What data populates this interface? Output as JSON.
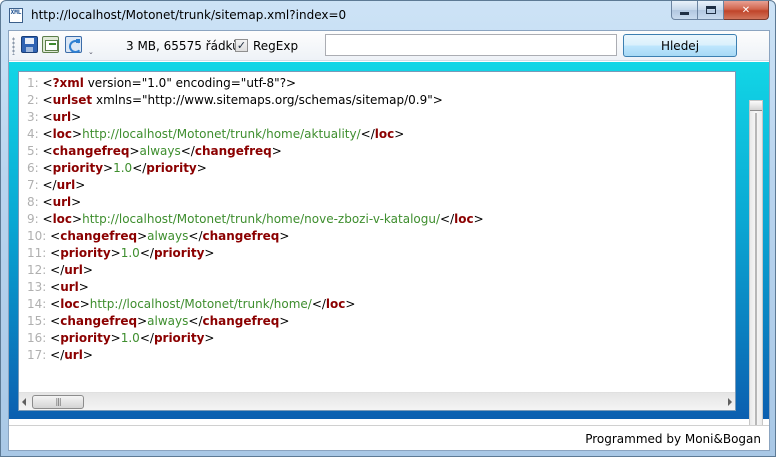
{
  "window": {
    "title": "http://localhost/Motonet/trunk/sitemap.xml?index=0",
    "app_icon_text": "XML",
    "minimize": "",
    "maximize": "",
    "close": "✕"
  },
  "toolbar": {
    "file_info": "3 MB, 65575 řádků",
    "regexp_label": "RegExp",
    "regexp_checked": "✓",
    "search_value": "",
    "search_button": "Hledej",
    "overflow": "⌄"
  },
  "code": {
    "lines": [
      {
        "n": "1:",
        "parts": [
          [
            "p",
            "<"
          ],
          [
            "t",
            "?xml"
          ],
          [
            "p",
            " version=\"1.0\" encoding=\"utf-8\"?>"
          ]
        ]
      },
      {
        "n": "2:",
        "parts": [
          [
            "p",
            "<"
          ],
          [
            "t",
            "urlset"
          ],
          [
            "p",
            " xmlns=\"http://www.sitemaps.org/schemas/sitemap/0.9\">"
          ]
        ]
      },
      {
        "n": "3:",
        "parts": [
          [
            "p",
            "<"
          ],
          [
            "t",
            "url"
          ],
          [
            "p",
            ">"
          ]
        ]
      },
      {
        "n": "4:",
        "parts": [
          [
            "p",
            "<"
          ],
          [
            "t",
            "loc"
          ],
          [
            "p",
            ">"
          ],
          [
            "tv",
            "http://localhost/Motonet/trunk/home/aktuality/"
          ],
          [
            "p",
            "</"
          ],
          [
            "t",
            "loc"
          ],
          [
            "p",
            ">"
          ]
        ]
      },
      {
        "n": "5:",
        "parts": [
          [
            "p",
            "<"
          ],
          [
            "t",
            "changefreq"
          ],
          [
            "p",
            ">"
          ],
          [
            "tv",
            "always"
          ],
          [
            "p",
            "</"
          ],
          [
            "t",
            "changefreq"
          ],
          [
            "p",
            ">"
          ]
        ]
      },
      {
        "n": "6:",
        "parts": [
          [
            "p",
            "<"
          ],
          [
            "t",
            "priority"
          ],
          [
            "p",
            ">"
          ],
          [
            "tv",
            "1.0"
          ],
          [
            "p",
            "</"
          ],
          [
            "t",
            "priority"
          ],
          [
            "p",
            ">"
          ]
        ]
      },
      {
        "n": "7:",
        "parts": [
          [
            "p",
            "</"
          ],
          [
            "t",
            "url"
          ],
          [
            "p",
            ">"
          ]
        ]
      },
      {
        "n": "8:",
        "parts": [
          [
            "p",
            "<"
          ],
          [
            "t",
            "url"
          ],
          [
            "p",
            ">"
          ]
        ]
      },
      {
        "n": "9:",
        "parts": [
          [
            "p",
            "<"
          ],
          [
            "t",
            "loc"
          ],
          [
            "p",
            ">"
          ],
          [
            "tv",
            "http://localhost/Motonet/trunk/home/nove-zbozi-v-katalogu/"
          ],
          [
            "p",
            "</"
          ],
          [
            "t",
            "loc"
          ],
          [
            "p",
            ">"
          ]
        ]
      },
      {
        "n": "10:",
        "parts": [
          [
            "p",
            "<"
          ],
          [
            "t",
            "changefreq"
          ],
          [
            "p",
            ">"
          ],
          [
            "tv",
            "always"
          ],
          [
            "p",
            "</"
          ],
          [
            "t",
            "changefreq"
          ],
          [
            "p",
            ">"
          ]
        ]
      },
      {
        "n": "11:",
        "parts": [
          [
            "p",
            "<"
          ],
          [
            "t",
            "priority"
          ],
          [
            "p",
            ">"
          ],
          [
            "tv",
            "1.0"
          ],
          [
            "p",
            "</"
          ],
          [
            "t",
            "priority"
          ],
          [
            "p",
            ">"
          ]
        ]
      },
      {
        "n": "12:",
        "parts": [
          [
            "p",
            "</"
          ],
          [
            "t",
            "url"
          ],
          [
            "p",
            ">"
          ]
        ]
      },
      {
        "n": "13:",
        "parts": [
          [
            "p",
            "<"
          ],
          [
            "t",
            "url"
          ],
          [
            "p",
            ">"
          ]
        ]
      },
      {
        "n": "14:",
        "parts": [
          [
            "p",
            "<"
          ],
          [
            "t",
            "loc"
          ],
          [
            "p",
            ">"
          ],
          [
            "tv",
            "http://localhost/Motonet/trunk/home/"
          ],
          [
            "p",
            "</"
          ],
          [
            "t",
            "loc"
          ],
          [
            "p",
            ">"
          ]
        ]
      },
      {
        "n": "15:",
        "parts": [
          [
            "p",
            "<"
          ],
          [
            "t",
            "changefreq"
          ],
          [
            "p",
            ">"
          ],
          [
            "tv",
            "always"
          ],
          [
            "p",
            "</"
          ],
          [
            "t",
            "changefreq"
          ],
          [
            "p",
            ">"
          ]
        ]
      },
      {
        "n": "16:",
        "parts": [
          [
            "p",
            "<"
          ],
          [
            "t",
            "priority"
          ],
          [
            "p",
            ">"
          ],
          [
            "tv",
            "1.0"
          ],
          [
            "p",
            "</"
          ],
          [
            "t",
            "priority"
          ],
          [
            "p",
            ">"
          ]
        ]
      },
      {
        "n": "17:",
        "parts": [
          [
            "p",
            "</"
          ],
          [
            "t",
            "url"
          ],
          [
            "p",
            ">"
          ]
        ]
      }
    ]
  },
  "scrollbar": {
    "thumb_grip": "|||"
  },
  "status": {
    "credits": "Programmed by Moni&Bogan"
  },
  "colors": {
    "tag": "#8b0000",
    "value": "#3e8e2e",
    "line_number": "#b0b0b0",
    "editor_top": "#12d6e6",
    "editor_bottom": "#0b5fb0"
  }
}
